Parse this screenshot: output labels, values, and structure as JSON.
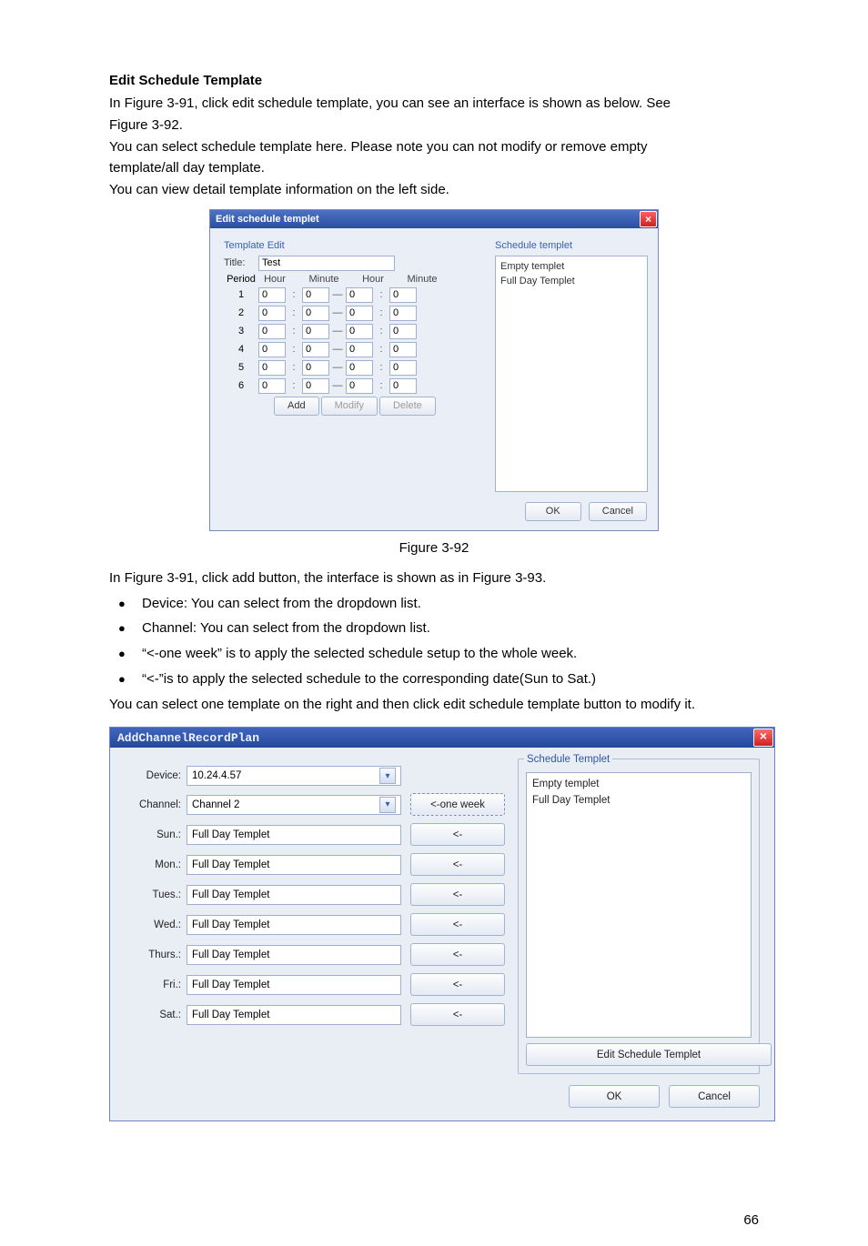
{
  "doc": {
    "heading": "Edit Schedule Template",
    "p1a": "In Figure 3-91, click edit schedule template, you can see an interface is shown as below. See",
    "p1b": "Figure 3-92.",
    "p2a": "You can select schedule template here. Please note you can not modify or remove empty",
    "p2b": "template/all day template.",
    "p3": "You can view detail template information on the left side.",
    "fig92": "Figure 3-92",
    "p4": "In Figure 3-91, click add button, the interface is shown as in Figure 3-93.",
    "bullets": [
      "Device: You can select from the dropdown list.",
      "Channel: You can select from the dropdown list.",
      "“<-one week” is to apply the selected schedule setup to the whole week.",
      "“<-”is to apply the selected schedule to the corresponding date(Sun to Sat.)"
    ],
    "p5": "You can select one template on the right and then click edit schedule template button to modify it.",
    "pagenum": "66"
  },
  "dlg1": {
    "title": "Edit schedule templet",
    "template_edit": "Template Edit",
    "schedule_templet": "Schedule templet",
    "title_label": "Title:",
    "title_value": "Test",
    "period_label": "Period",
    "headers": {
      "h1": "Hour",
      "h2": "Minute",
      "h3": "Hour",
      "h4": "Minute"
    },
    "colon": ":",
    "dash": "—",
    "rows": [
      {
        "n": "1",
        "a": "0",
        "b": "0",
        "c": "0",
        "d": "0"
      },
      {
        "n": "2",
        "a": "0",
        "b": "0",
        "c": "0",
        "d": "0"
      },
      {
        "n": "3",
        "a": "0",
        "b": "0",
        "c": "0",
        "d": "0"
      },
      {
        "n": "4",
        "a": "0",
        "b": "0",
        "c": "0",
        "d": "0"
      },
      {
        "n": "5",
        "a": "0",
        "b": "0",
        "c": "0",
        "d": "0"
      },
      {
        "n": "6",
        "a": "0",
        "b": "0",
        "c": "0",
        "d": "0"
      }
    ],
    "buttons": {
      "add": "Add",
      "modify": "Modify",
      "delete": "Delete",
      "ok": "OK",
      "cancel": "Cancel"
    },
    "templates": {
      "empty": "Empty templet",
      "full": "Full Day Templet"
    }
  },
  "dlg2": {
    "title": "AddChannelRecordPlan",
    "labels": {
      "device": "Device:",
      "channel": "Channel:",
      "sun": "Sun.:",
      "mon": "Mon.:",
      "tue": "Tues.:",
      "wed": "Wed.:",
      "thu": "Thurs.:",
      "fri": "Fri.:",
      "sat": "Sat.:"
    },
    "values": {
      "device": "10.24.4.57",
      "channel": "Channel 2",
      "days": {
        "sun": "Full Day Templet",
        "mon": "Full Day Templet",
        "tue": "Full Day Templet",
        "wed": "Full Day Templet",
        "thu": "Full Day Templet",
        "fri": "Full Day Templet",
        "sat": "Full Day Templet"
      }
    },
    "buttons": {
      "one_week": "<-one week",
      "apply": "<-",
      "edit": "Edit Schedule Templet",
      "ok": "OK",
      "cancel": "Cancel"
    },
    "fieldset_title": "Schedule Templet",
    "templates": {
      "empty": "Empty templet",
      "full": "Full Day Templet"
    }
  }
}
